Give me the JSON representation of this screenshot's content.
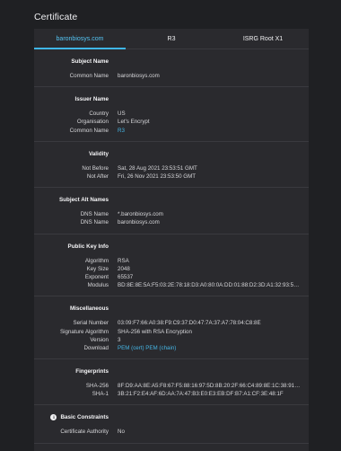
{
  "page_title": "Certificate",
  "tabs": [
    {
      "label": "baronbiosys.com",
      "active": true
    },
    {
      "label": "R3",
      "active": false
    },
    {
      "label": "ISRG Root X1",
      "active": false
    }
  ],
  "sections": {
    "subject": {
      "title": "Subject Name",
      "rows": [
        {
          "label": "Common Name",
          "value": "baronbiosys.com"
        }
      ]
    },
    "issuer": {
      "title": "Issuer Name",
      "rows": [
        {
          "label": "Country",
          "value": "US"
        },
        {
          "label": "Organisation",
          "value": "Let's Encrypt"
        },
        {
          "label": "Common Name",
          "value": "R3"
        }
      ]
    },
    "validity": {
      "title": "Validity",
      "rows": [
        {
          "label": "Not Before",
          "value": "Sat, 28 Aug 2021 23:53:51 GMT"
        },
        {
          "label": "Not After",
          "value": "Fri, 26 Nov 2021 23:53:50 GMT"
        }
      ]
    },
    "san": {
      "title": "Subject Alt Names",
      "rows": [
        {
          "label": "DNS Name",
          "value": "*.baronbiosys.com"
        },
        {
          "label": "DNS Name",
          "value": "baronbiosys.com"
        }
      ]
    },
    "pubkey": {
      "title": "Public Key Info",
      "rows": [
        {
          "label": "Algorithm",
          "value": "RSA"
        },
        {
          "label": "Key Size",
          "value": "2048"
        },
        {
          "label": "Exponent",
          "value": "65537"
        },
        {
          "label": "Modulus",
          "value": "BD:8E:8E:5A:F5:03:2E:78:18:D3:A0:80:0A:DD:01:88:D2:3D:A1:32:93:5C:65:04:36:A..."
        }
      ]
    },
    "misc": {
      "title": "Miscellaneous",
      "rows": [
        {
          "label": "Serial Number",
          "value": "03:09:F7:66:A0:38:F9:C9:37:D0:47:7A:37:A7:78:04:C8:8E"
        },
        {
          "label": "Signature Algorithm",
          "value": "SHA-256 with RSA Encryption"
        },
        {
          "label": "Version",
          "value": "3"
        },
        {
          "label": "Download",
          "value": "PEM (cert) PEM (chain)"
        }
      ]
    },
    "fingerprints": {
      "title": "Fingerprints",
      "rows": [
        {
          "label": "SHA-256",
          "value": "8F:D9:AA:8E:A5:F8:67:F5:88:16:97:5D:8B:20:2F:66:C4:89:8E:1C:38:91:B2:C7:16:38..."
        },
        {
          "label": "SHA-1",
          "value": "3B:21:F2:E4:AF:6D:AA:7A:47:B3:E0:E3:EB:DF:B7:A1:CF:3E:48:1F"
        }
      ]
    },
    "constraints": {
      "title": "Basic Constraints",
      "icon": "info-icon",
      "rows": [
        {
          "label": "Certificate Authority",
          "value": "No"
        }
      ]
    }
  }
}
